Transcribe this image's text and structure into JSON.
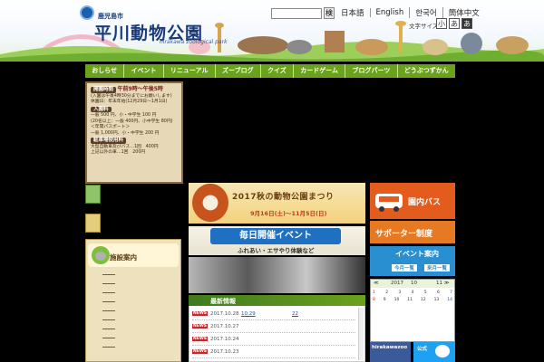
{
  "header": {
    "city": "鹿児島市",
    "park_title": "平川動物公園",
    "park_title_en": "hirakawa zoological park",
    "search_button": "検",
    "languages": [
      "日本語",
      "English",
      "한국어",
      "簡体中文"
    ],
    "font_size_label": "文字サイズ",
    "font_sizes": [
      "小",
      "あ",
      "あ"
    ]
  },
  "nav": {
    "items": [
      "おしらせ",
      "イベント",
      "リニューアル",
      "ズーブログ",
      "クイズ",
      "カードゲーム",
      "ブログパーツ",
      "どうぶつずかん"
    ]
  },
  "info": {
    "hours_tag": "開園時間",
    "hours": "午前9時〜午後5時",
    "hours_note": "(入園は午後4時30分までにお願いします)",
    "closed": "休園日：年末年始(12月29日〜1月1日)",
    "fee_tag": "入園料",
    "fee_adult": "一般 500 円、小・中学生 100 円",
    "fee_group": "(20名以上：一般 400円、小中学生 80円)",
    "pass_label": "＜年間パスポート＞",
    "pass_price": "一般 1,000円、小・中学生 200 円",
    "parking_tag": "駐車場使用料",
    "parking_car": "大型自動車及びバス…1回　400円",
    "parking_other": "上記以外の車…1回　200円"
  },
  "facility": {
    "title": "施設案内"
  },
  "banners": {
    "festival_title": "2017秋の動物公園まつり",
    "festival_date": "9月16日(土)〜11月5日(日)",
    "daily_title": "毎日開催イベント",
    "daily_sub": "ふれあい・エサやり体験など"
  },
  "news": {
    "heading": "最新情報",
    "badge": "NEWS",
    "rows": [
      {
        "date": "2017.10.28",
        "title": "10.29",
        "extra": "22"
      },
      {
        "date": "2017.10.27",
        "title": "",
        "extra": ""
      },
      {
        "date": "2017.10.24",
        "title": "",
        "extra": ""
      },
      {
        "date": "2017.10.23",
        "title": "",
        "extra": ""
      }
    ]
  },
  "right": {
    "bus_label": "園内バス",
    "supporter_label": "サポーター制度",
    "event_label": "イベント案内",
    "event_sub1": "今月一覧",
    "event_sub2": "来月一覧",
    "cal_prev": "≪",
    "cal_year": "2017",
    "cal_month": "10",
    "cal_next": "11 ≫",
    "cal_row1": [
      "1",
      "2",
      "3",
      "4",
      "5",
      "6",
      "7"
    ],
    "cal_row2": [
      "8",
      "9",
      "10",
      "11",
      "12",
      "13",
      "14"
    ],
    "social_fb": "hirakawazoo",
    "social_tw": "公式"
  }
}
